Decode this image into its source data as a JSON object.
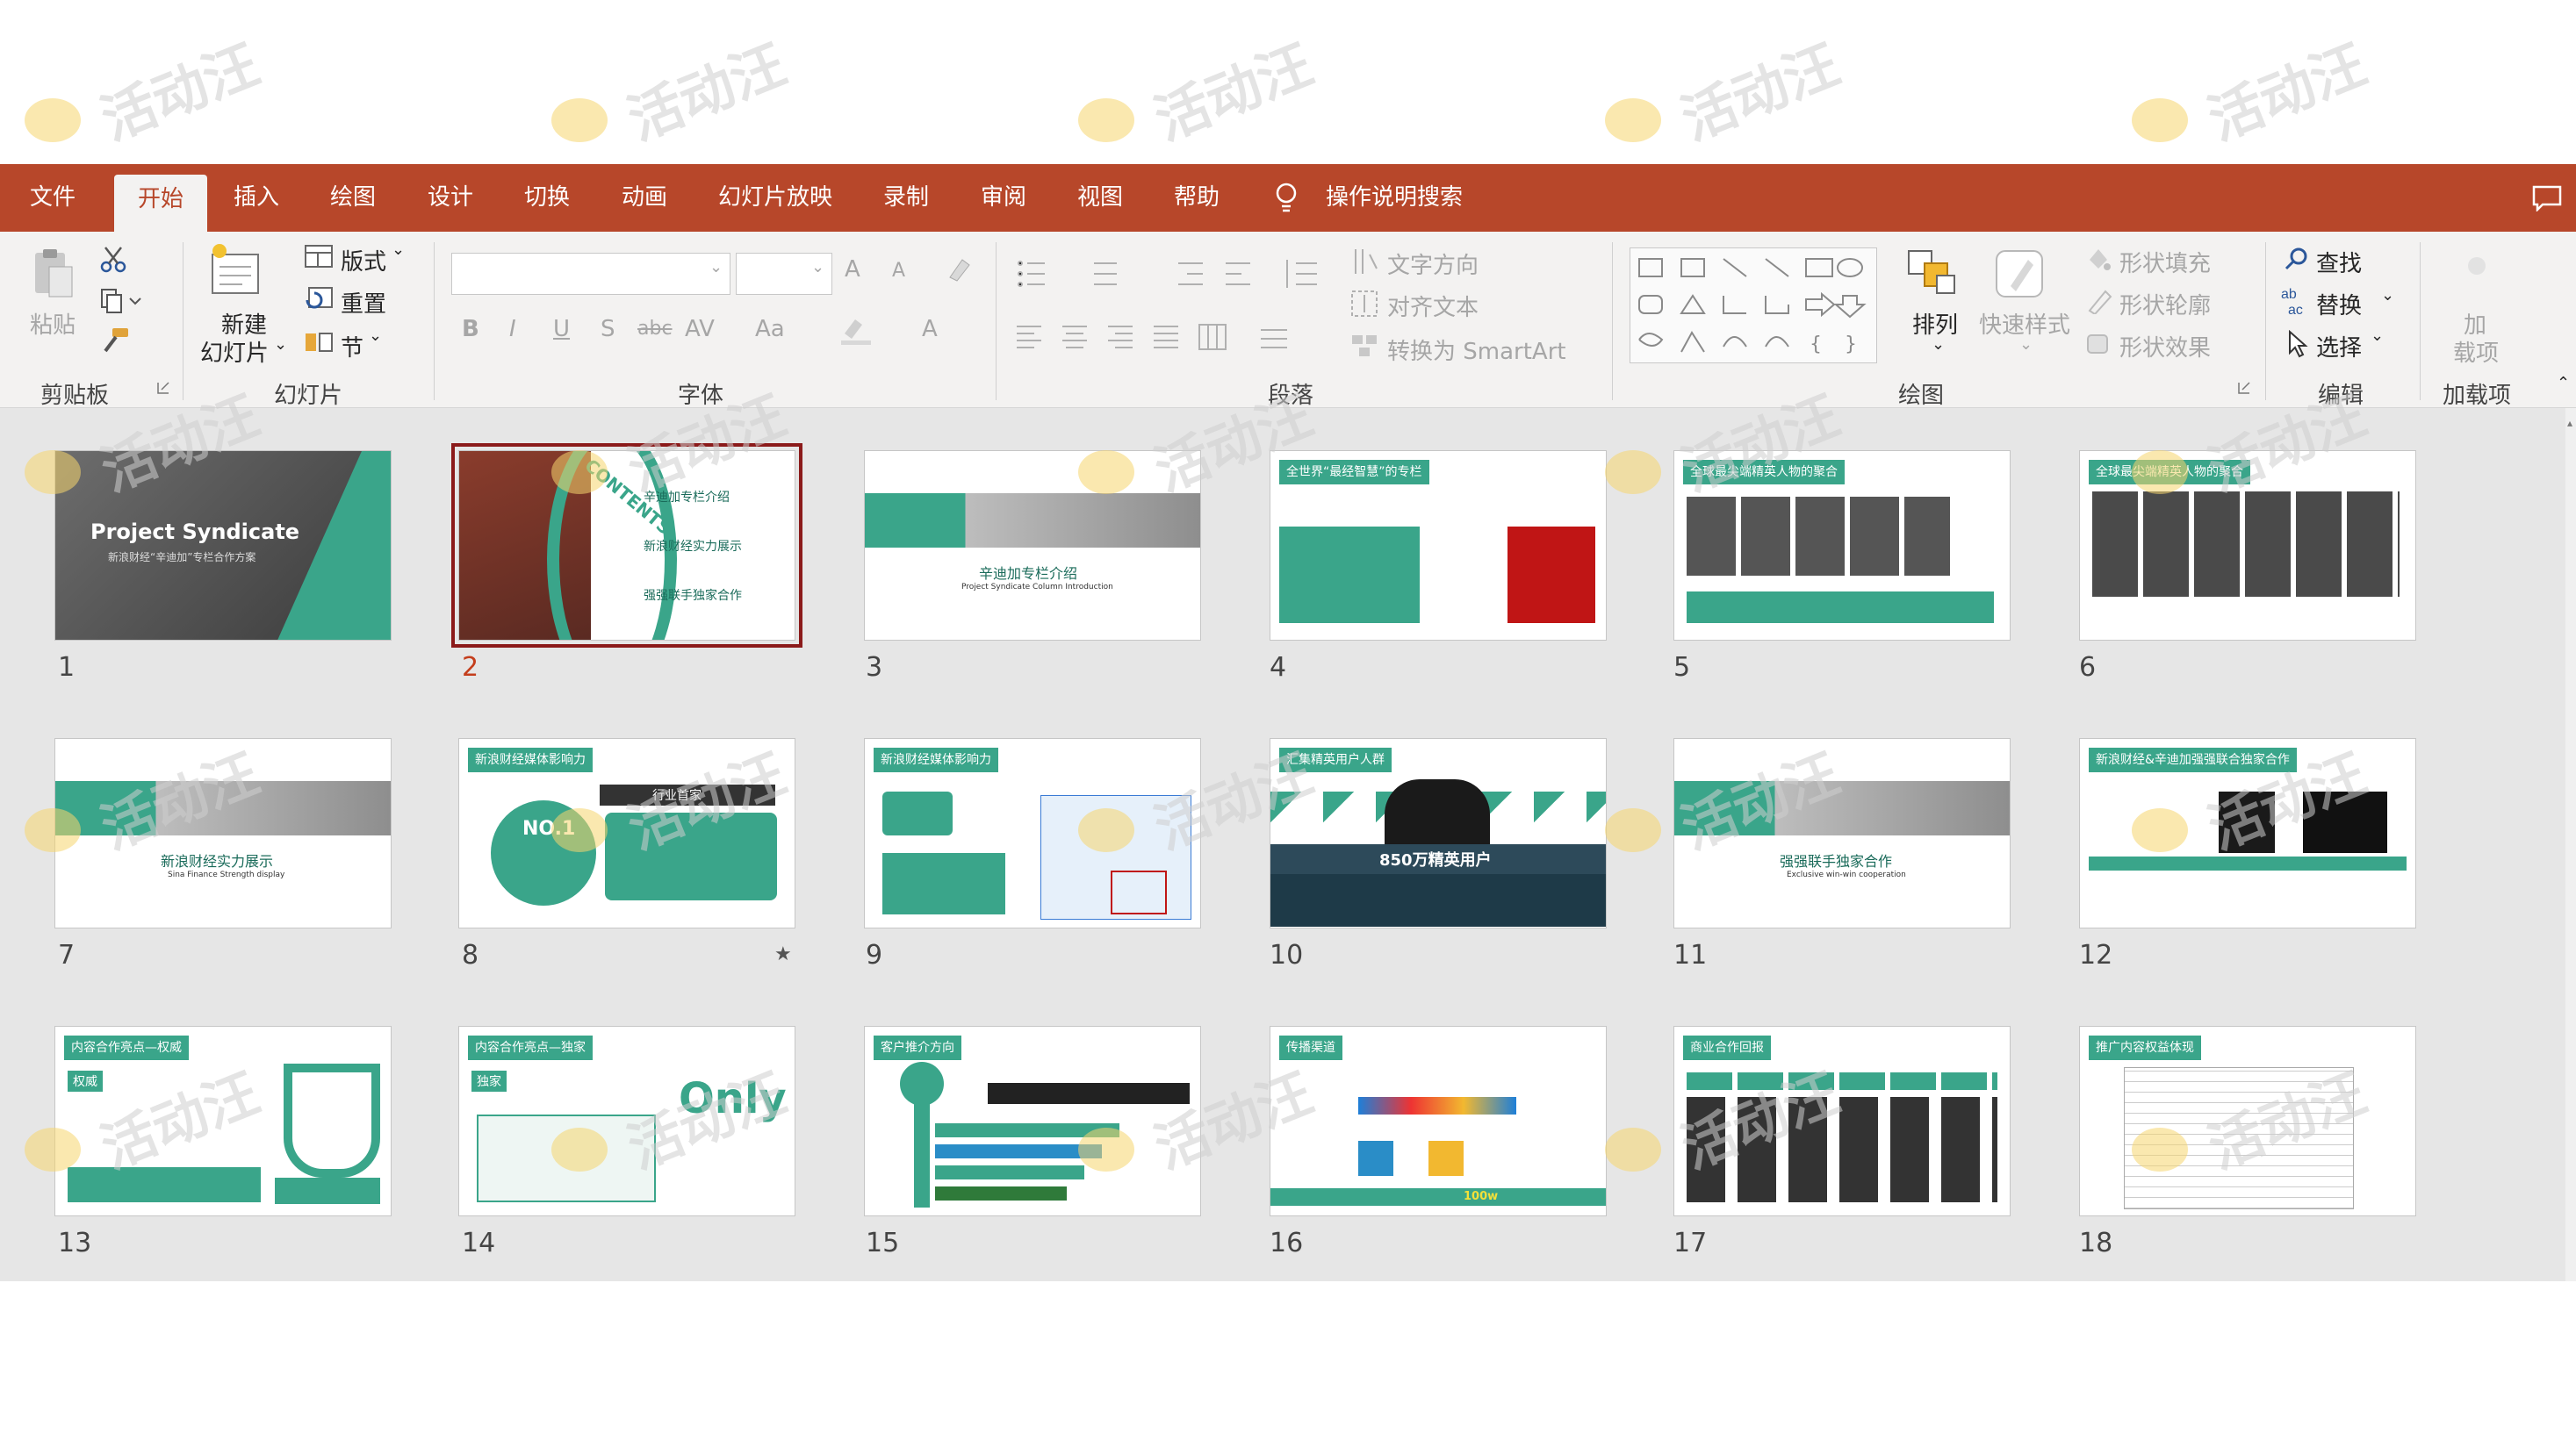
{
  "tabs": [
    "文件",
    "开始",
    "插入",
    "绘图",
    "设计",
    "切换",
    "动画",
    "幻灯片放映",
    "录制",
    "审阅",
    "视图",
    "帮助"
  ],
  "active_tab": "开始",
  "tell_me": "操作说明搜索",
  "ribbon": {
    "clipboard": {
      "paste": "粘贴",
      "group": "剪贴板"
    },
    "slides": {
      "new_slide_1": "新建",
      "new_slide_2": "幻灯片",
      "layout": "版式",
      "reset": "重置",
      "section": "节",
      "group": "幻灯片"
    },
    "font": {
      "group": "字体",
      "bold": "B",
      "italic": "I",
      "underline": "U",
      "shadow": "S",
      "strike": "abc",
      "spacing": "AV",
      "case": "Aa",
      "grow": "A",
      "shrink": "A",
      "color": "A"
    },
    "paragraph": {
      "text_direction": "文字方向",
      "align_text": "对齐文本",
      "smartart": "转换为 SmartArt",
      "group": "段落"
    },
    "drawing": {
      "arrange": "排列",
      "quick_styles": "快速样式",
      "shape_fill": "形状填充",
      "shape_outline": "形状轮廓",
      "shape_effects": "形状效果",
      "group": "绘图"
    },
    "editing": {
      "find": "查找",
      "replace": "替换",
      "select": "选择",
      "group": "编辑"
    },
    "addins": {
      "addin_1": "加",
      "addin_2": "载项",
      "group": "加载项"
    }
  },
  "watermark": "活动汪",
  "colors": {
    "accent": "#b7472a",
    "teal": "#3aa58a",
    "selected": "#8b1a1a"
  },
  "slides": [
    {
      "number": "1",
      "title": "Project Syndicate",
      "subtitle": "新浪财经“辛迪加”专栏合作方案"
    },
    {
      "number": "2",
      "title": "CONTENTS",
      "items": [
        "辛迪加专栏介绍",
        "新浪财经实力展示",
        "强强联手独家合作"
      ]
    },
    {
      "number": "3",
      "title": "辛迪加专栏介绍",
      "subtitle": "Project Syndicate Column Introduction"
    },
    {
      "number": "4",
      "title": "全世界“最经智慧”的专栏"
    },
    {
      "number": "5",
      "title": "全球最尖端精英人物的聚合"
    },
    {
      "number": "6",
      "title": "全球最尖端精英人物的聚合"
    },
    {
      "number": "7",
      "title": "新浪财经实力展示",
      "subtitle": "Sina Finance Strength display"
    },
    {
      "number": "8",
      "title": "新浪财经媒体影响力",
      "badge": "NO.1",
      "tag": "行业首家"
    },
    {
      "number": "9",
      "title": "新浪财经媒体影响力"
    },
    {
      "number": "10",
      "title": "汇集精英用户人群",
      "band": "850万精英用户"
    },
    {
      "number": "11",
      "title": "强强联手独家合作",
      "subtitle": "Exclusive win-win cooperation"
    },
    {
      "number": "12",
      "title": "新浪财经&辛迪加强强联合独家合作"
    },
    {
      "number": "13",
      "title": "内容合作亮点—权威",
      "tag": "权威"
    },
    {
      "number": "14",
      "title": "内容合作亮点—独家",
      "tag": "独家",
      "big": "Only"
    },
    {
      "number": "15",
      "title": "客户推介方向"
    },
    {
      "number": "16",
      "title": "传播渠道",
      "footer": "100w"
    },
    {
      "number": "17",
      "title": "商业合作回报"
    },
    {
      "number": "18",
      "title": "推广内容权益体现"
    }
  ]
}
